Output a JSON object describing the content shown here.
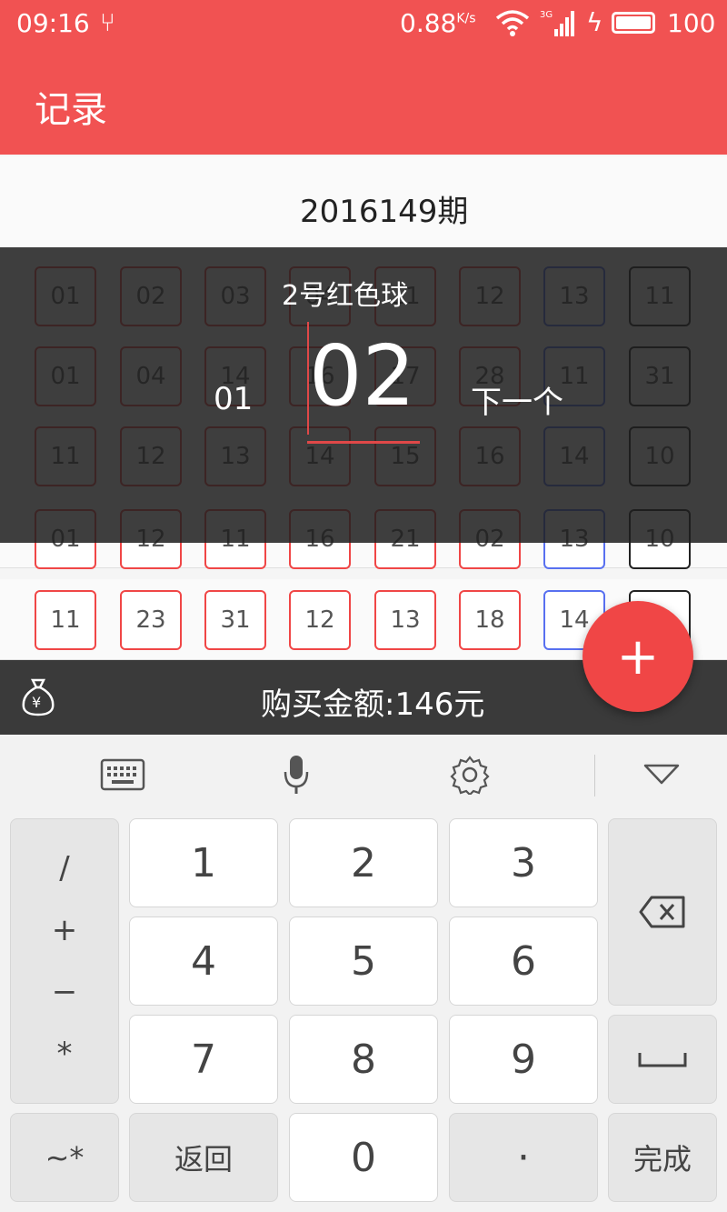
{
  "status_bar": {
    "time": "09:16",
    "speed": "0.88",
    "speed_unit": "K/s",
    "network": "3G",
    "battery": "100"
  },
  "app_bar": {
    "title": "记录"
  },
  "period": {
    "label": "2016149期"
  },
  "ball_rows": [
    [
      "01",
      "02",
      "03",
      "04",
      "11",
      "12",
      "13",
      "11"
    ],
    [
      "01",
      "04",
      "14",
      "16",
      "17",
      "28",
      "11",
      "31"
    ],
    [
      "11",
      "12",
      "13",
      "14",
      "15",
      "16",
      "14",
      "10"
    ],
    [
      "01",
      "12",
      "11",
      "16",
      "21",
      "02",
      "13",
      "10"
    ],
    [
      "11",
      "23",
      "31",
      "12",
      "13",
      "18",
      "14",
      ""
    ]
  ],
  "picker": {
    "title": "2号红色球",
    "previous": "01",
    "current": "02",
    "next": "下一个"
  },
  "fab": {
    "label": "+"
  },
  "amount": {
    "text": "购买金额:146元"
  },
  "keyboard": {
    "symbols": [
      "/",
      "+",
      "−",
      "*"
    ],
    "digits": [
      "1",
      "2",
      "3",
      "4",
      "5",
      "6",
      "7",
      "8",
      "9"
    ],
    "zero": "0",
    "dot": "·",
    "tilde_star": "~*",
    "back": "返回",
    "done": "完成"
  },
  "colors": {
    "primary": "#f15252",
    "red_ball": "#f04646",
    "blue_ball": "#5870f0",
    "dark_bar": "#3a3a3a"
  }
}
